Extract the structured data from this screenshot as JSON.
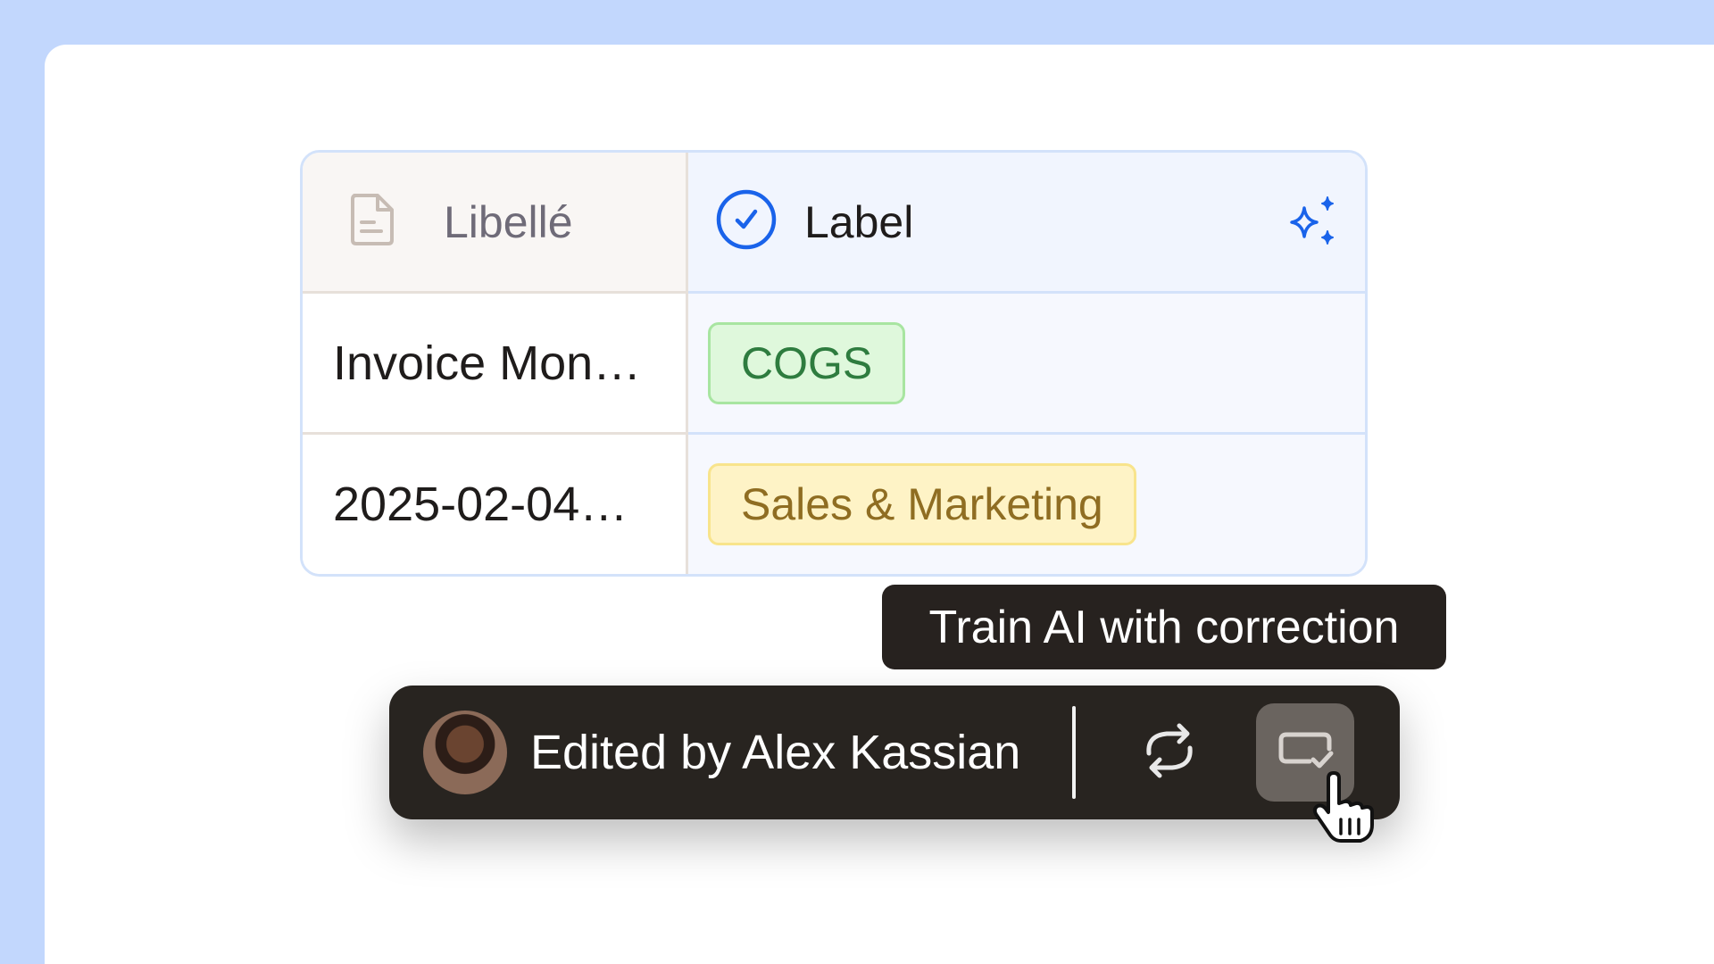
{
  "table": {
    "headers": {
      "left": {
        "label": "Libellé",
        "icon": "document-icon"
      },
      "right": {
        "label": "Label",
        "icon": "check-circle-icon",
        "action_icon": "sparkle-icon"
      }
    },
    "rows": [
      {
        "libelle": "Invoice Mon…",
        "label": "COGS",
        "label_color": "green"
      },
      {
        "libelle": "2025-02-04…",
        "label": "Sales & Marketing",
        "label_color": "yellow"
      }
    ]
  },
  "tooltip": {
    "text": "Train AI with correction"
  },
  "toolbar": {
    "edited_text": "Edited by Alex Kassian",
    "buttons": [
      {
        "name": "refresh",
        "icon": "refresh-icon"
      },
      {
        "name": "train-ai",
        "icon": "train-ai-icon"
      }
    ]
  },
  "colors": {
    "background": "#c2d7fd",
    "accent": "#1a63ea",
    "toolbar": "#282420",
    "green_tag": "#dff8dc",
    "yellow_tag": "#fef3c6"
  }
}
